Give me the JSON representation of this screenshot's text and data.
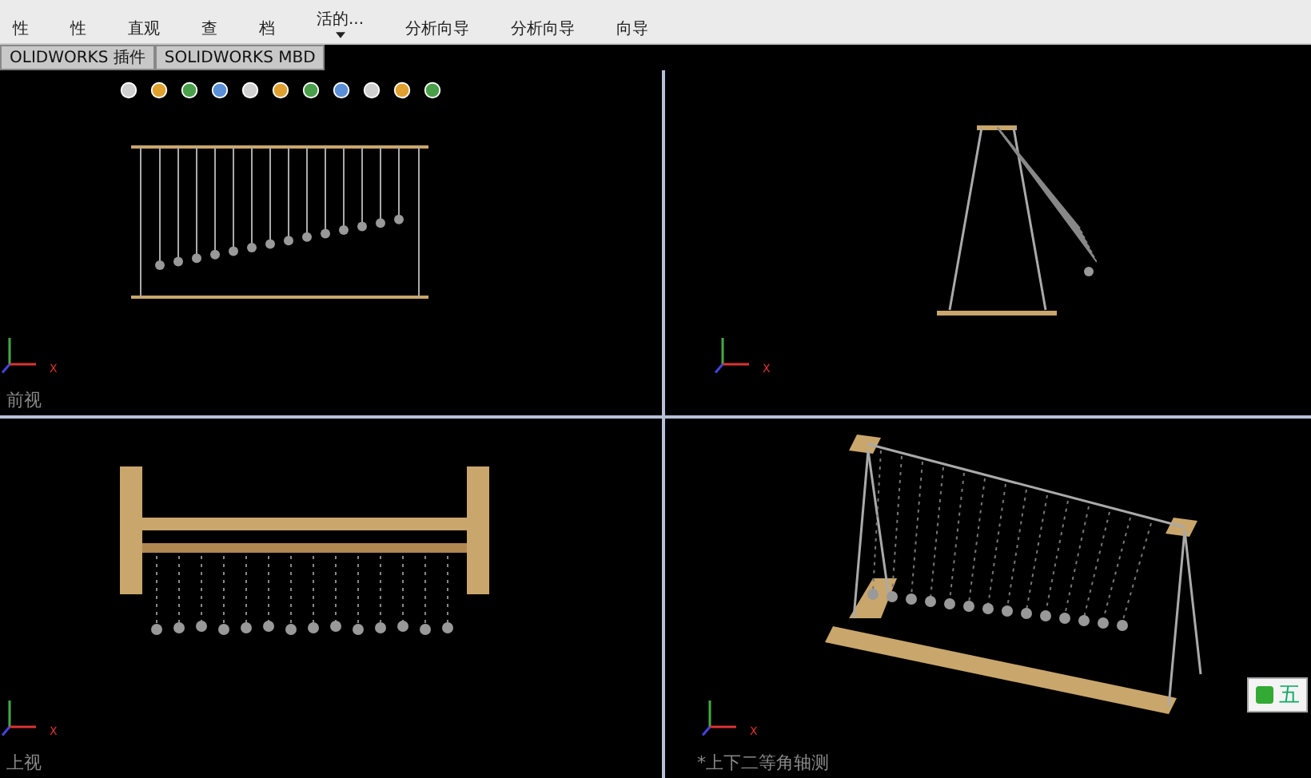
{
  "ribbon": {
    "items": [
      {
        "label": "性"
      },
      {
        "label": "性"
      },
      {
        "label": "直观"
      },
      {
        "label": "查"
      },
      {
        "label": "档"
      },
      {
        "label": "活的...",
        "dropdown": true
      },
      {
        "label": "分析向导"
      },
      {
        "label": "分析向导"
      },
      {
        "label": "向导"
      }
    ]
  },
  "tabs": [
    {
      "label": "OLIDWORKS 插件",
      "selected": false
    },
    {
      "label": "SOLIDWORKS MBD",
      "selected": false
    }
  ],
  "viewports": [
    {
      "kind": "front",
      "label": "前视",
      "axis_label": "X"
    },
    {
      "kind": "right",
      "axis_label": "X"
    },
    {
      "kind": "top",
      "label": "上视",
      "axis_label": "X"
    },
    {
      "kind": "iso",
      "label": "*上下二等角轴测",
      "axis_label": "X"
    }
  ],
  "ime": {
    "label": "五"
  }
}
